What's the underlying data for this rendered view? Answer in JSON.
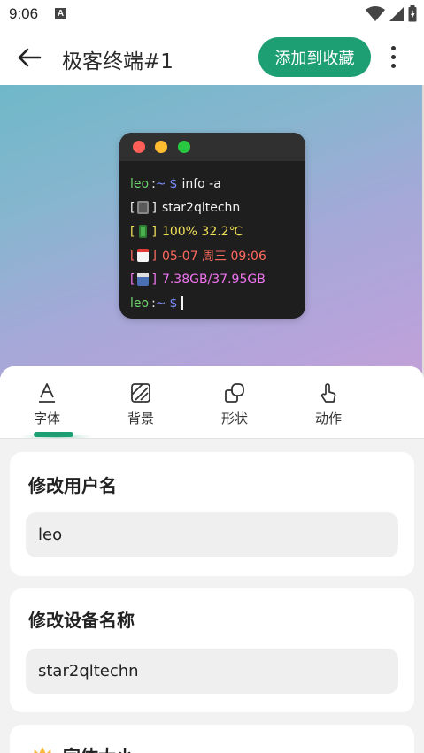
{
  "status_bar": {
    "time": "9:06",
    "notification_badge": "A"
  },
  "app_bar": {
    "title": "极客终端#1",
    "favorite_label": "添加到收藏"
  },
  "terminal": {
    "prompt_user": "leo",
    "prompt_sep": ":",
    "prompt_path": "~",
    "prompt_symbol": "$",
    "command": "info -a",
    "device_label": "star2qltechn",
    "battery": "100% 32.2℃",
    "date": "05-07 周三 09:06",
    "storage": "7.38GB/37.95GB",
    "bracket_open": "[",
    "bracket_close": "]",
    "colors": {
      "user": "#6fd36f",
      "path": "#7a8cff",
      "battery": "#f1e05a",
      "date": "#ff6b5e",
      "storage": "#f074f0"
    }
  },
  "tabs": [
    {
      "label": "字体",
      "icon": "font-icon",
      "selected": true
    },
    {
      "label": "背景",
      "icon": "background-pattern-icon",
      "selected": false
    },
    {
      "label": "形状",
      "icon": "shapes-icon",
      "selected": false
    },
    {
      "label": "动作",
      "icon": "touch-gesture-icon",
      "selected": false
    }
  ],
  "username_card": {
    "title": "修改用户名",
    "value": "leo"
  },
  "device_card": {
    "title": "修改设备名称",
    "value": "star2qltechn"
  },
  "font_size_card": {
    "title": "字体大小",
    "icon": "crown-icon"
  },
  "accent_color": "#1e9e73"
}
